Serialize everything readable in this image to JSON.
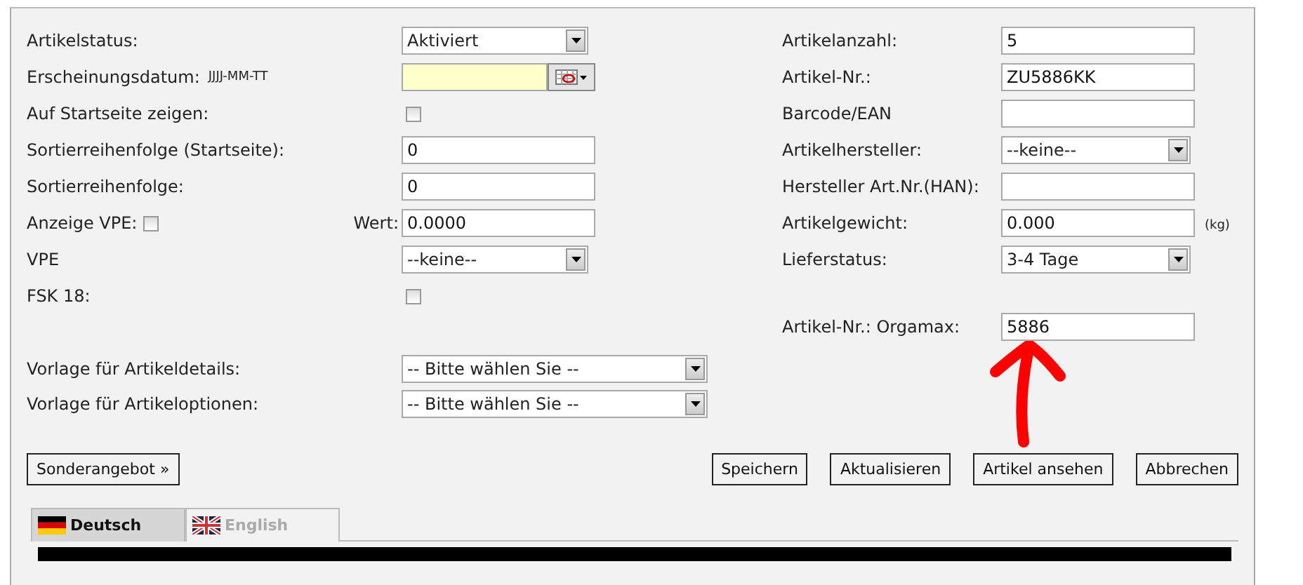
{
  "left_fields": [
    {
      "kind": "select",
      "label": "Artikelstatus:",
      "value": "Aktiviert"
    },
    {
      "kind": "date",
      "label": "Erscheinungsdatum:",
      "hint": "JJJJ-MM-TT"
    },
    {
      "kind": "checkbox",
      "label": "Auf Startseite zeigen:",
      "checked": false
    },
    {
      "kind": "text",
      "label": "Sortierreihenfolge (Startseite):",
      "value": "0"
    },
    {
      "kind": "text",
      "label": "Sortierreihenfolge:",
      "value": "0"
    },
    {
      "kind": "vpe",
      "label": "Anzeige VPE:",
      "checked": false,
      "value_label": "Wert:",
      "value": "0.0000"
    },
    {
      "kind": "select",
      "label": "VPE",
      "value": "--keine--"
    },
    {
      "kind": "checkbox",
      "label": "FSK 18:",
      "checked": false
    }
  ],
  "template_fields": [
    {
      "label": "Vorlage für Artikeldetails:",
      "value": "-- Bitte wählen Sie --"
    },
    {
      "label": "Vorlage für Artikeloptionen:",
      "value": "-- Bitte wählen Sie --"
    }
  ],
  "right_fields": [
    {
      "kind": "text",
      "label": "Artikelanzahl:",
      "value": "5"
    },
    {
      "kind": "text",
      "label": "Artikel-Nr.:",
      "value": "ZU5886KK"
    },
    {
      "kind": "text",
      "label": "Barcode/EAN"
    },
    {
      "kind": "select",
      "label": "Artikelhersteller:",
      "value": "--keine--"
    },
    {
      "kind": "text",
      "label": "Hersteller Art.Nr.(HAN):"
    },
    {
      "kind": "text",
      "label": "Artikelgewicht:",
      "value": "0.000",
      "unit": "(kg)"
    },
    {
      "kind": "select",
      "label": "Lieferstatus:",
      "value": "3-4 Tage"
    }
  ],
  "orgamax_field": {
    "label": "Artikel-Nr.: Orgamax:",
    "value": "5886"
  },
  "special_offer_button": "Sonderangebot »",
  "action_buttons": [
    "Speichern",
    "Aktualisieren",
    "Artikel ansehen",
    "Abbrechen"
  ],
  "language_tabs": [
    {
      "label": "Deutsch",
      "kind": "de",
      "selected": true
    },
    {
      "label": "English",
      "kind": "gb",
      "selected": false
    }
  ]
}
